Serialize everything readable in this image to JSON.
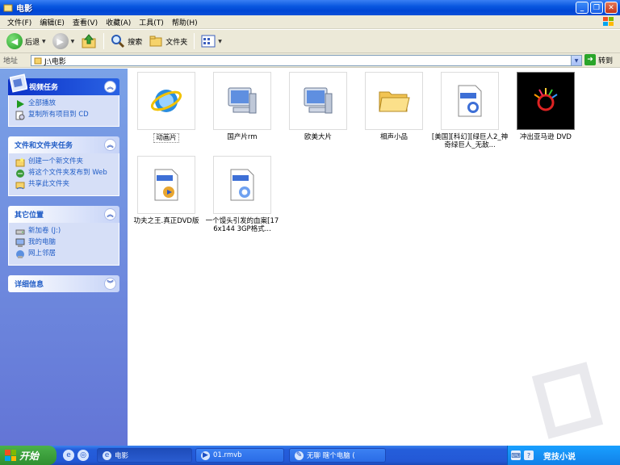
{
  "window": {
    "title": "电影"
  },
  "menu": [
    "文件(F)",
    "编辑(E)",
    "查看(V)",
    "收藏(A)",
    "工具(T)",
    "帮助(H)"
  ],
  "toolbar": {
    "back_label": "后退",
    "search_label": "搜索",
    "folders_label": "文件夹"
  },
  "address": {
    "label": "地址",
    "value": "J:\\电影",
    "go_label": "转到"
  },
  "sidebar": {
    "video_tasks": {
      "title": "视频任务",
      "items": [
        "全部播放",
        "复制所有项目到 CD"
      ]
    },
    "file_tasks": {
      "title": "文件和文件夹任务",
      "items": [
        "创建一个新文件夹",
        "将这个文件夹发布到 Web",
        "共享此文件夹"
      ]
    },
    "other_places": {
      "title": "其它位置",
      "items": [
        "新加卷 (J:)",
        "我的电脑",
        "网上邻居"
      ]
    },
    "details": {
      "title": "详细信息"
    }
  },
  "files": [
    {
      "name": "动画片",
      "icon": "ie-globe-icon"
    },
    {
      "name": "国产片rm",
      "icon": "computer-icon"
    },
    {
      "name": "欧美大片",
      "icon": "computer-icon"
    },
    {
      "name": "相声小品",
      "icon": "folder-icon"
    },
    {
      "name": "[美国][科幻][绿巨人2_神奇绿巨人_无敌...",
      "icon": "real-file-icon"
    },
    {
      "name": "冲出亚马逊 DVD",
      "icon": "video-thumbnail"
    },
    {
      "name": "功夫之王.真正DVD版",
      "icon": "avi-file-icon"
    },
    {
      "name": "一个馒头引发的血案[176x144 3GP格式...",
      "icon": "qt-file-icon"
    }
  ],
  "taskbar": {
    "start_label": "开始",
    "tasks": [
      "电影",
      "01.rmvb",
      "无聊 瞎个电脑 ("
    ],
    "tray_text": "竞技小说"
  },
  "colors": {
    "accent": "#0a58e0",
    "sidebar": "#6f8fe0",
    "start": "#2f8f2f"
  }
}
